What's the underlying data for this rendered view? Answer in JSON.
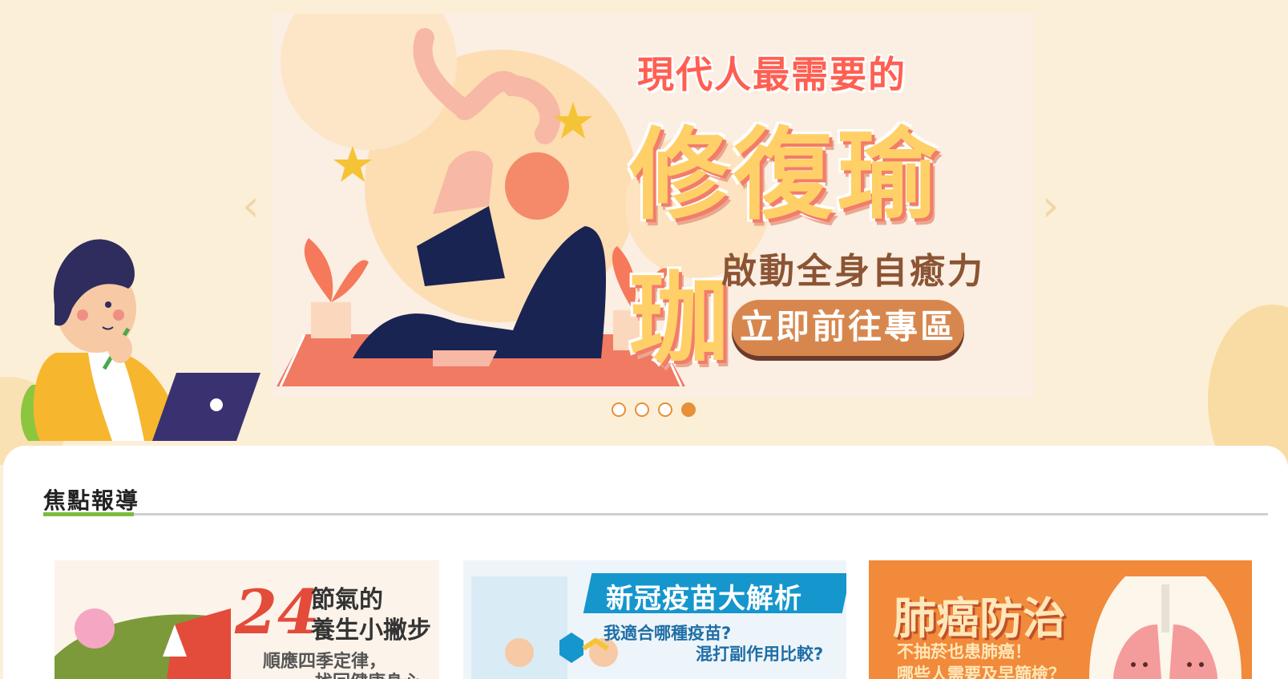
{
  "banner": {
    "kicker": "現代人最需要的",
    "title": "修復瑜珈",
    "subtitle": "啟動全身自癒力",
    "cta": "立即前往專區",
    "prev_icon": "chevron-left-icon",
    "next_icon": "chevron-right-icon",
    "slides": 4,
    "active_slide": 4
  },
  "section": {
    "title": "焦點報導"
  },
  "cards": [
    {
      "number": "24",
      "line1": "節氣的",
      "line2": "養生小撇步",
      "line3": "順應四季定律，",
      "line4": "找回健康身心"
    },
    {
      "title": "新冠疫苗大解析",
      "line1": "我適合哪種疫苗?",
      "line2": "混打副作用比較?"
    },
    {
      "title": "肺癌防治",
      "line1": "不抽菸也患肺癌！",
      "line2": "哪些人需要及早篩檢？"
    }
  ],
  "colors": {
    "background": "#fcefd8",
    "accent_orange": "#e88f39",
    "accent_green": "#7dbb3d",
    "cta": "#d7874d",
    "vaccine_blue": "#1596cd",
    "lung_orange": "#f18a3a"
  }
}
